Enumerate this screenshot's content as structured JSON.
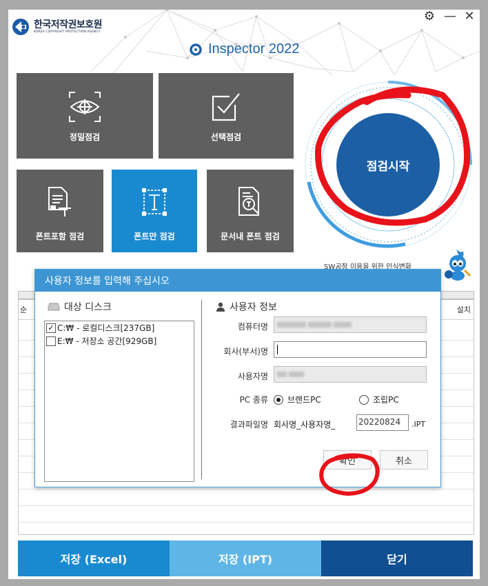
{
  "brand": {
    "name_kr": "한국저작권보호원",
    "name_en": "KOREA COPYRIGHT PROTECTION AGENCY"
  },
  "product": {
    "name": "Inspector 2022"
  },
  "window_controls": {
    "settings": "⚙",
    "minimize": "—",
    "close": "✕"
  },
  "tiles": {
    "precise": "정밀점검",
    "selective": "선택점검",
    "font_include": "폰트포함 점검",
    "font_only": "폰트만 점검",
    "doc_font": "문서내 폰트 점검"
  },
  "start_button": "점검시작",
  "hint_text": "SW공정 이용을 위한 인식변화",
  "grid": {
    "left_col": "순",
    "right_col": "설치"
  },
  "bottom_buttons": {
    "excel": "저장 (Excel)",
    "ipt": "저장 (IPT)",
    "close": "닫기"
  },
  "colors": {
    "blue": "#1a8ad0",
    "dark_blue": "#1c5fa5",
    "gray_tile": "#5f5f5f",
    "title_bar": "#3d96d3",
    "annotation_red": "#e8121a"
  },
  "dialog": {
    "title": "사용자 정보를 입력해 주십시오",
    "disk_section": "대상 디스크",
    "disks": [
      {
        "label": "C:₩ - 로컬디스크[237GB]",
        "checked": true
      },
      {
        "label": "E:₩ - 저장소 공간[929GB]",
        "checked": false
      }
    ],
    "user_section": "사용자 정보",
    "fields": {
      "computer_name": "컴퓨터명",
      "company": "회사(부서)명",
      "user_name": "사용자명",
      "pc_type": "PC 종류",
      "result_file": "결과파일명"
    },
    "pc_options": {
      "brand": "브랜드PC",
      "assembled": "조립PC",
      "selected": "brand"
    },
    "result_prefix": "회사명_사용자명_",
    "result_date": "20220824",
    "result_ext": ".IPT",
    "ok": "확인",
    "cancel": "취소"
  }
}
